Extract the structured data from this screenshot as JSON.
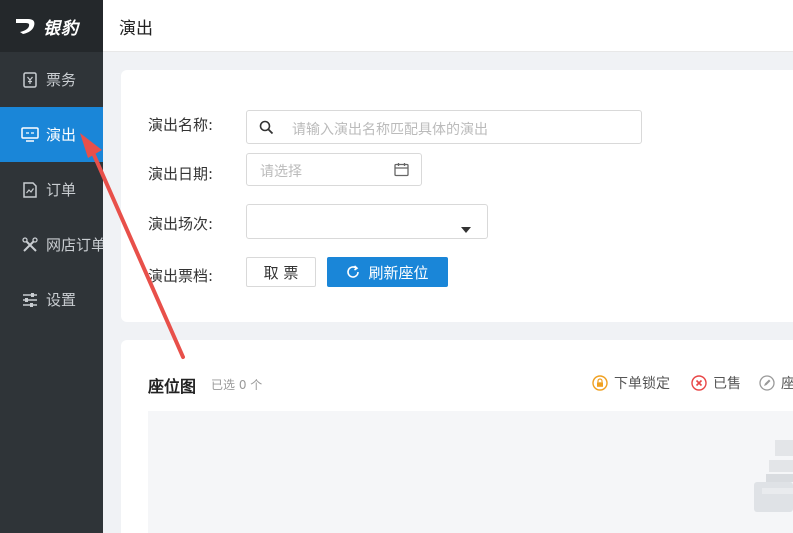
{
  "app": {
    "logo_text": "银豹"
  },
  "sidebar": {
    "items": [
      {
        "label": "票务",
        "icon": "ticket-icon"
      },
      {
        "label": "演出",
        "icon": "monitor-icon",
        "active": true
      },
      {
        "label": "订单",
        "icon": "order-icon"
      },
      {
        "label": "网店订单",
        "icon": "tools-icon"
      },
      {
        "label": "设置",
        "icon": "sliders-icon"
      }
    ]
  },
  "header": {
    "title": "演出"
  },
  "form": {
    "name_label": "演出名称:",
    "name_placeholder": "请输入演出名称匹配具体的演出",
    "date_label": "演出日期:",
    "date_placeholder": "请选择",
    "session_label": "演出场次:",
    "session_value": "",
    "tier_label": "演出票档:",
    "cancel_ticket_label": "取 票",
    "refresh_label": "刷新座位"
  },
  "seat_map": {
    "title": "座位图",
    "selected_text": "已选 0 个",
    "legend": [
      {
        "label": "下单锁定",
        "icon": "lock-icon",
        "color": "#f0a020"
      },
      {
        "label": "已售",
        "icon": "x-circle-icon",
        "color": "#e84545"
      },
      {
        "label": "座",
        "icon": "pencil-icon",
        "color": "#999999"
      }
    ]
  },
  "colors": {
    "accent": "#1a86d8",
    "sidebar": "#2f3438",
    "annotation_arrow": "#e8504a"
  }
}
